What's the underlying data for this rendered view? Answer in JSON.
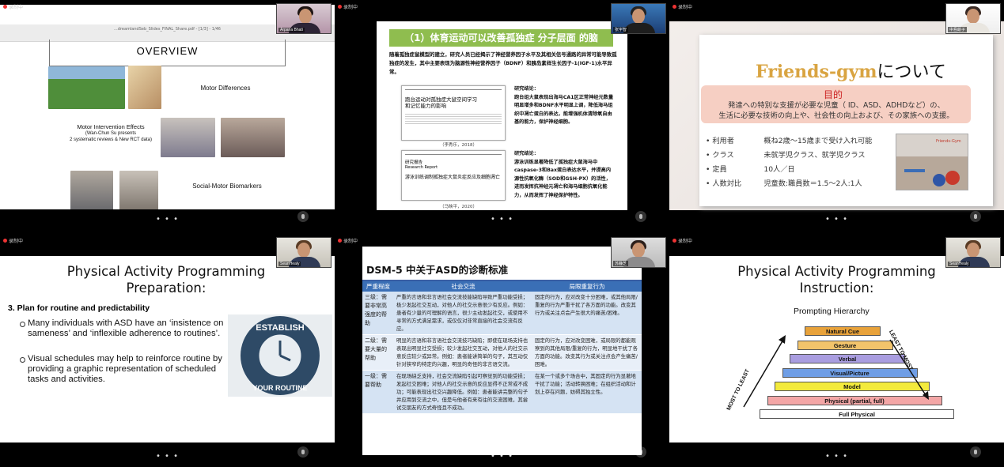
{
  "recording_label": "录制中",
  "more_dots": "• • •",
  "tiles": {
    "t1": {
      "participant": "Arpana Bhati",
      "tab_title": "...dreamlandSeb_Slides_FINAL_Share.pdf - [1/3] - 1/46",
      "overview": "OVERVIEW",
      "motor_diff": "Motor Differences",
      "intervention": "Motor Intervention Effects",
      "intervention_sub1": "(Wan-Chun Su presents",
      "intervention_sub2": "2 systematic reviews & New RCT data)",
      "biomarkers": "Social-Motor Biomarkers"
    },
    "t2": {
      "participant": "张宇智",
      "header": "（1）体育运动可以改善孤独症 分子层面 的脑",
      "intro": "随着孤独症鼠模型的建立，研究人员已经揭示了神经营养因子水平及其相关信号通路的异常可能导致孤独症的发生，其中主要表现为脑源性神经营养因子（BDNF）和胰岛素样生长因子-1(IGF-1)水平异常。",
      "paper1_title": "跑台运动对孤独症大鼠空间学习和记忆能力的影响",
      "paper1_cite": "（李秀乐，2018）",
      "concl1_head": "研究结论：",
      "concl1": "跑台组大鼠表现出海马CA1区正常神经元数量明显增多和BDNF水平明显上调，降低海马组织中凋亡蛋白的表达，能增强机体清除氧自由基的能力，保护神经细胞。",
      "paper2_label": "研究报告",
      "paper2_label_en": "Research Report",
      "paper2_title": "游泳训练调制孤独症大鼠炎症反应及细胞凋亡",
      "paper2_cite": "（马映平，2020）",
      "concl2_head": "研究结论：",
      "concl2": "游泳训练显著降低了孤独症大鼠海马中caspase-3和Bax蛋白表达水平，并提高内源性抗氧化酶（SOD和GSH-PX）的活性，进而发挥抗神经元凋亡和海马细胞抗氧化能力，从而发挥了神经保护特性。"
    },
    "t3": {
      "participant": "中島絵子",
      "title_brand": "Friends-gym",
      "title_suffix": "について",
      "purpose_label": "目的",
      "purpose_text1": "発達への特別な支援が必要な児童（ ID、ASD、ADHDなど）の、",
      "purpose_text2": "生活に必要な技術の向上や、社会性の向上および、その家族への支援。",
      "rows": [
        {
          "k": "利用者",
          "v": "概ね2歳〜15歳まで受け入れ可能"
        },
        {
          "k": "クラス",
          "v": "未就学児クラス、就学児クラス"
        },
        {
          "k": "定員",
          "v": "10人／日"
        },
        {
          "k": "人数対比",
          "v": "児童数:職員数＝1.5〜2人:1人"
        }
      ],
      "gym_sign": "Friends-Gym"
    },
    "t4": {
      "participant": "SeanHealy",
      "title1": "Physical Activity Programming",
      "title2": "Preparation:",
      "section": "3. Plan for routine and predictability",
      "bullet1": "Many individuals with ASD have an ‘insistence on sameness’ and ‘inflexible adherence to routines’.",
      "bullet2": "Visual schedules may help to reinforce routine by providing a graphic representation of scheduled tasks and activities.",
      "badge_top": "ESTABLISH",
      "badge_bottom": "YOUR ROUTINE"
    },
    "t5": {
      "participant": "苏静芝",
      "title": "DSM-5 中关于ASD的诊断标准",
      "col1": "严重程度",
      "col2": "社会交流",
      "col3": "局限重复行为",
      "rows": [
        {
          "level": "三级：需要非常高强度的帮助",
          "social": "严重的言语和非言语社会交流技能缺陷导致严重功能受损；极少发起社交互动，对他人的社交示意很少有反应。例如：患者有少量的可理解的语言，很少主动发起社交，或使用不寻常的方式满足需求，或仅仅对非常直接的社会交流有反应。",
          "repetitive": "固定的行为，应对改变十分困难，或其他局限/重复的行为严重干扰了各方面的功能。改变其行为或关注点会产生很大的痛苦/困难。"
        },
        {
          "level": "二级：需要大量的帮助",
          "social": "明显的言语和非言语社会交流技巧缺陷；即使在现场支持也表现出明显社交受损；较少发起社交互动，对他人的社交示意反应较少或异常。例如：患者能讲简单的句子，其互动仅针对狭窄的特定的兴趣，明显的奇怪的非言语交流。",
          "repetitive": "固定的行为，应对改变困难，或局限的都能观察到的其他局限/重复的行为，明显地干扰了各方面的功能。改变其行为或关注点会产生痛苦/困难。"
        },
        {
          "level": "一级：需要帮助",
          "social": "在现场缺乏支持，社会交流缺陷引起可察觉到的功能受损；发起社交困难；对他人的社交示意的反应显得不正常或不成功；可能表现出社交兴趣降低。例如：患者能讲完整的句子并应用到交流之中，但是与他者有来有往的交流困难，其尝试交朋友的方式奇怪且不成功。",
          "repetitive": "在某一个或多个场合中，其固定的行为显著地干扰了功能；活动转换困难；在组织活动和计划上存在问题，妨碍其独立性。"
        }
      ]
    },
    "t6": {
      "participant": "SeanHealy",
      "title1": "Physical Activity Programming",
      "title2": "Instruction:",
      "subtitle": "Prompting Hierarchy",
      "levels": [
        "Natural Cue",
        "Gesture",
        "Verbal",
        "Visual/Picture",
        "Model",
        "Physical (partial, full)",
        "Full Physical"
      ],
      "level_colors": [
        "#e8a23a",
        "#f2c46b",
        "#a99de0",
        "#6f9ee6",
        "#f3ea3c",
        "#f3a6a6",
        "#ffffff"
      ],
      "left_arrow": "MOST TO LEAST",
      "right_arrow": "LEAST TO MOST"
    }
  }
}
